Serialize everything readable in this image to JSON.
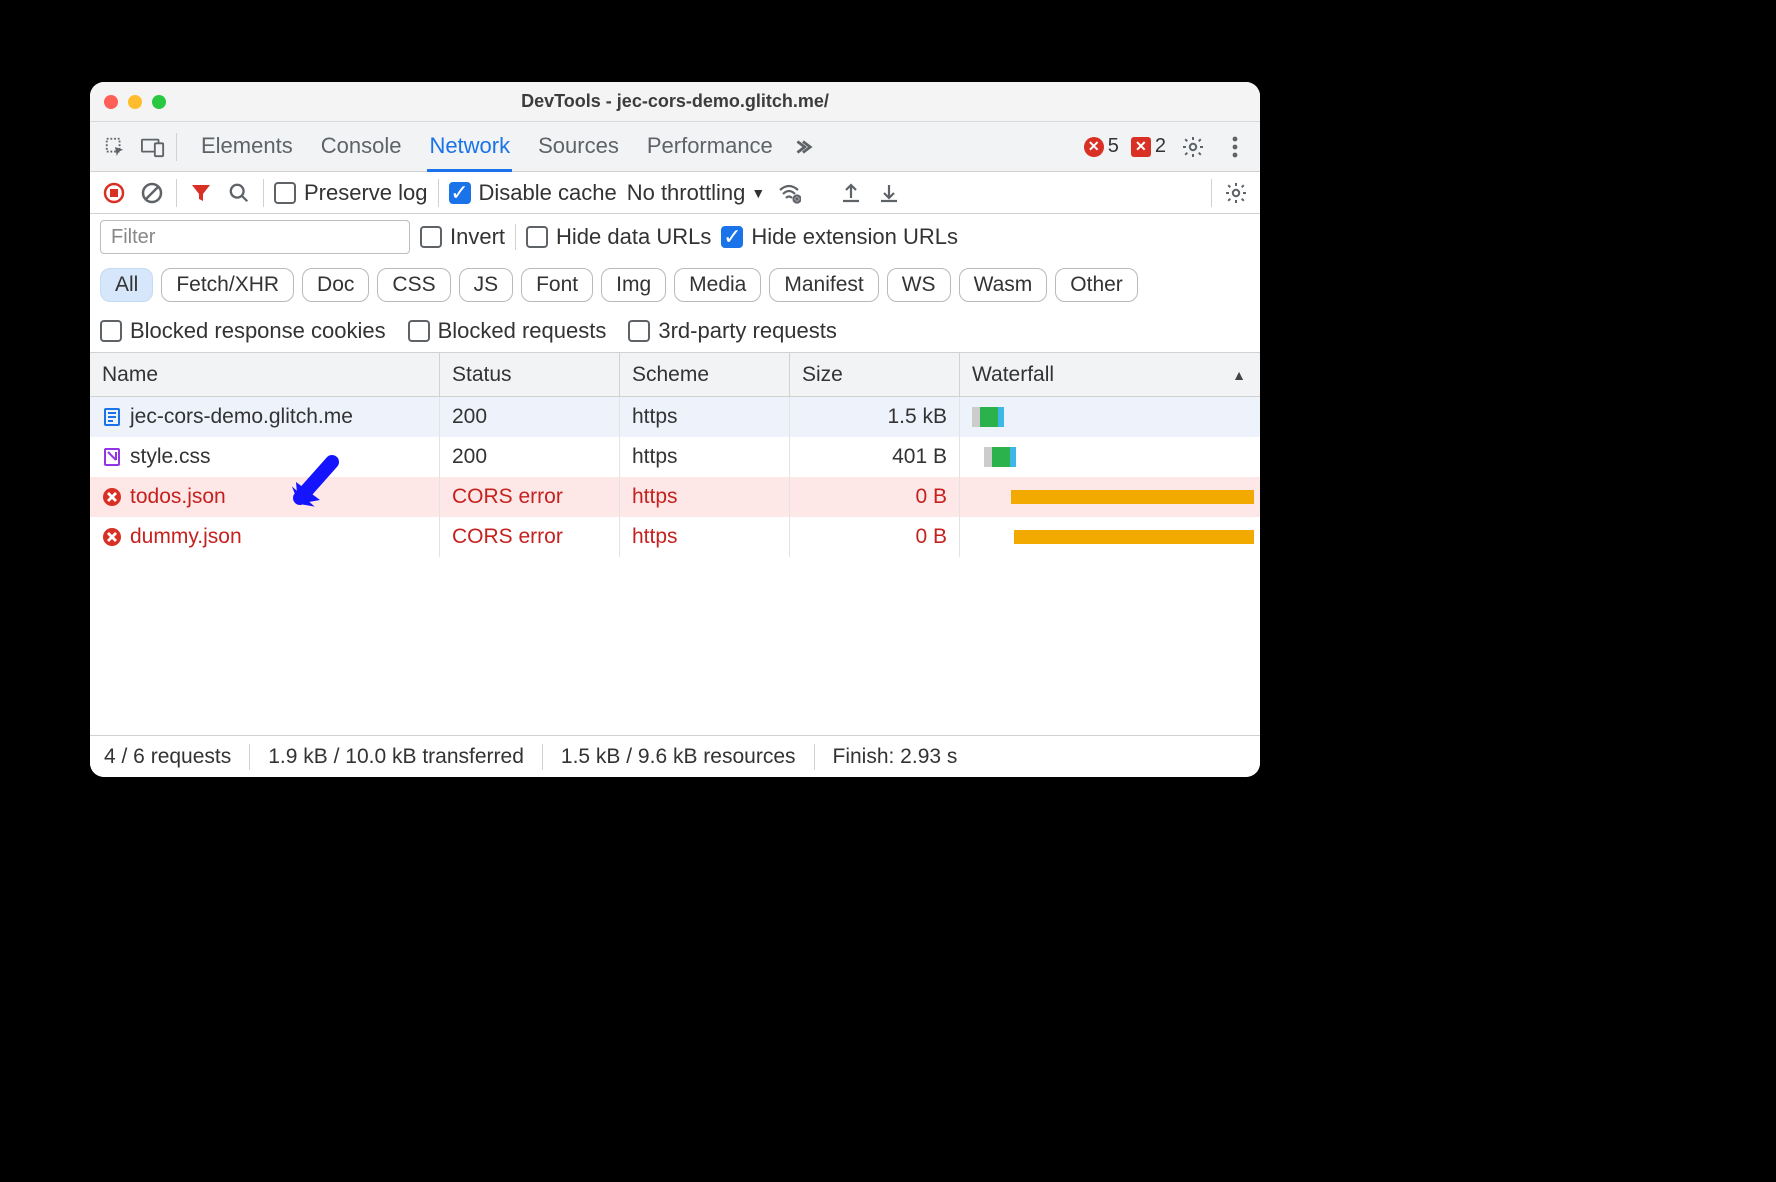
{
  "window": {
    "title": "DevTools - jec-cors-demo.glitch.me/"
  },
  "tabs": {
    "items": [
      "Elements",
      "Console",
      "Network",
      "Sources",
      "Performance"
    ],
    "active": "Network"
  },
  "errors": {
    "count_a": "5",
    "count_b": "2"
  },
  "toolbar": {
    "preserve_log": "Preserve log",
    "disable_cache": "Disable cache",
    "throttling": "No throttling"
  },
  "filter": {
    "placeholder": "Filter",
    "invert": "Invert",
    "hide_data_urls": "Hide data URLs",
    "hide_ext_urls": "Hide extension URLs",
    "types": [
      "All",
      "Fetch/XHR",
      "Doc",
      "CSS",
      "JS",
      "Font",
      "Img",
      "Media",
      "Manifest",
      "WS",
      "Wasm",
      "Other"
    ],
    "blocked_cookies": "Blocked response cookies",
    "blocked_requests": "Blocked requests",
    "third_party": "3rd-party requests"
  },
  "table": {
    "columns": {
      "name": "Name",
      "status": "Status",
      "scheme": "Scheme",
      "size": "Size",
      "waterfall": "Waterfall"
    },
    "rows": [
      {
        "name": "jec-cors-demo.glitch.me",
        "status": "200",
        "scheme": "https",
        "size": "1.5 kB",
        "icon": "doc",
        "error": false
      },
      {
        "name": "style.css",
        "status": "200",
        "scheme": "https",
        "size": "401 B",
        "icon": "css",
        "error": false
      },
      {
        "name": "todos.json",
        "status": "CORS error",
        "scheme": "https",
        "size": "0 B",
        "icon": "err",
        "error": true,
        "highlight": true
      },
      {
        "name": "dummy.json",
        "status": "CORS error",
        "scheme": "https",
        "size": "0 B",
        "icon": "err",
        "error": true
      }
    ]
  },
  "status": {
    "requests": "4 / 6 requests",
    "transferred": "1.9 kB / 10.0 kB transferred",
    "resources": "1.5 kB / 9.6 kB resources",
    "finish": "Finish: 2.93 s"
  }
}
